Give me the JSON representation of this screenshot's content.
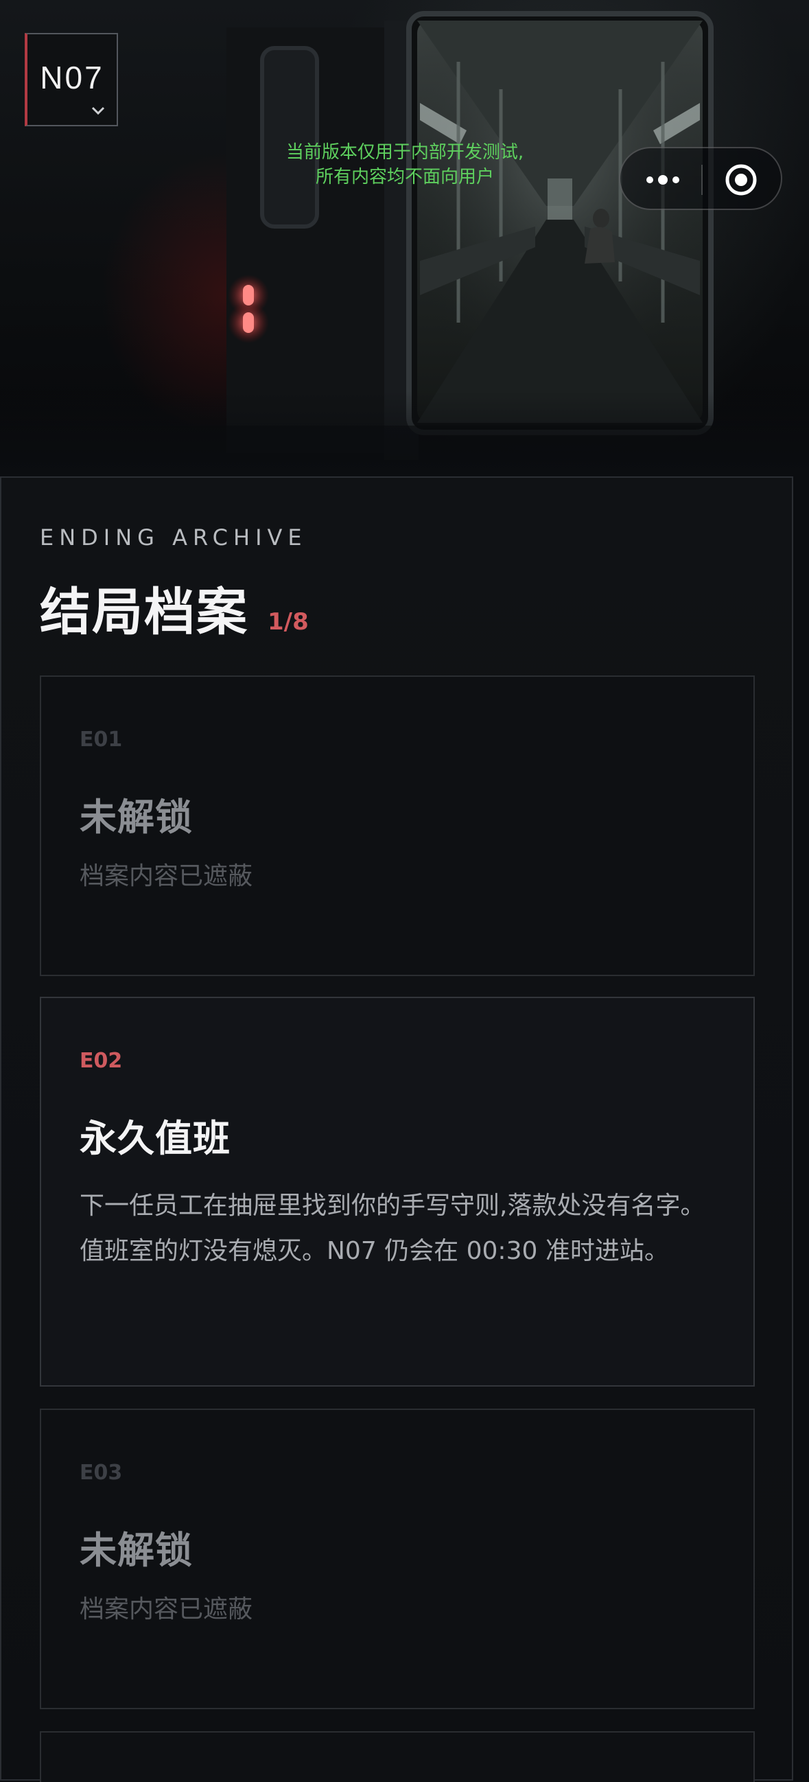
{
  "app": {
    "logo_text": "N07",
    "dev_notice_line1": "当前版本仅用于内部开发测试,",
    "dev_notice_line2": "所有内容均不面向用户"
  },
  "archive": {
    "overline": "ENDING ARCHIVE",
    "title": "结局档案",
    "progress": "1/8",
    "entries": [
      {
        "code": "E01",
        "title": "未解锁",
        "description": "档案内容已遮蔽",
        "unlocked": false
      },
      {
        "code": "E02",
        "title": "永久值班",
        "description": "下一任员工在抽屉里找到你的手写守则,落款处没有名字。值班室的灯没有熄灭。N07 仍会在 00:30 准时进站。",
        "unlocked": true
      },
      {
        "code": "E03",
        "title": "未解锁",
        "description": "档案内容已遮蔽",
        "unlocked": false
      }
    ]
  },
  "colors": {
    "accent_red": "#cf5a5f",
    "dev_notice_green": "#5ed05e",
    "background": "#0b0d10"
  },
  "icons": {
    "capsule_more": "more-dots-icon",
    "capsule_close": "target-close-icon",
    "logo_dropdown": "chevron-down-icon"
  }
}
